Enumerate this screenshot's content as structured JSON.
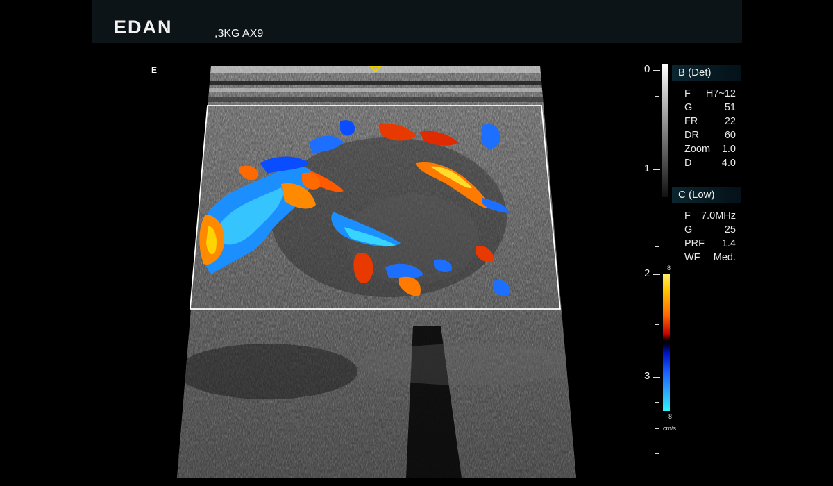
{
  "header": {
    "brand": "EDAN",
    "probe_preset": ",3KG AX9"
  },
  "orientation_marker": "E",
  "depth_scale": {
    "labels": [
      "0",
      "1",
      "2",
      "3"
    ]
  },
  "b_mode": {
    "title": "B (Det)",
    "params": [
      {
        "key": "F",
        "value": "H7~12"
      },
      {
        "key": "G",
        "value": "51"
      },
      {
        "key": "FR",
        "value": "22"
      },
      {
        "key": "DR",
        "value": "60"
      },
      {
        "key": "Zoom",
        "value": "1.0"
      },
      {
        "key": "D",
        "value": "4.0"
      }
    ]
  },
  "color_mode": {
    "title": "C (Low)",
    "params": [
      {
        "key": "F",
        "value": "7.0MHz"
      },
      {
        "key": "G",
        "value": "25"
      },
      {
        "key": "PRF",
        "value": "1.4"
      },
      {
        "key": "WF",
        "value": "Med."
      }
    ]
  },
  "color_scale": {
    "max": "8",
    "min": "-8",
    "unit": "cm/s"
  },
  "colors": {
    "header_bg": "#0d1417",
    "focus_marker": "#e6d000",
    "roi_box": "#ffffff"
  },
  "icons": {
    "focus_marker": "focus-triangle-icon"
  }
}
